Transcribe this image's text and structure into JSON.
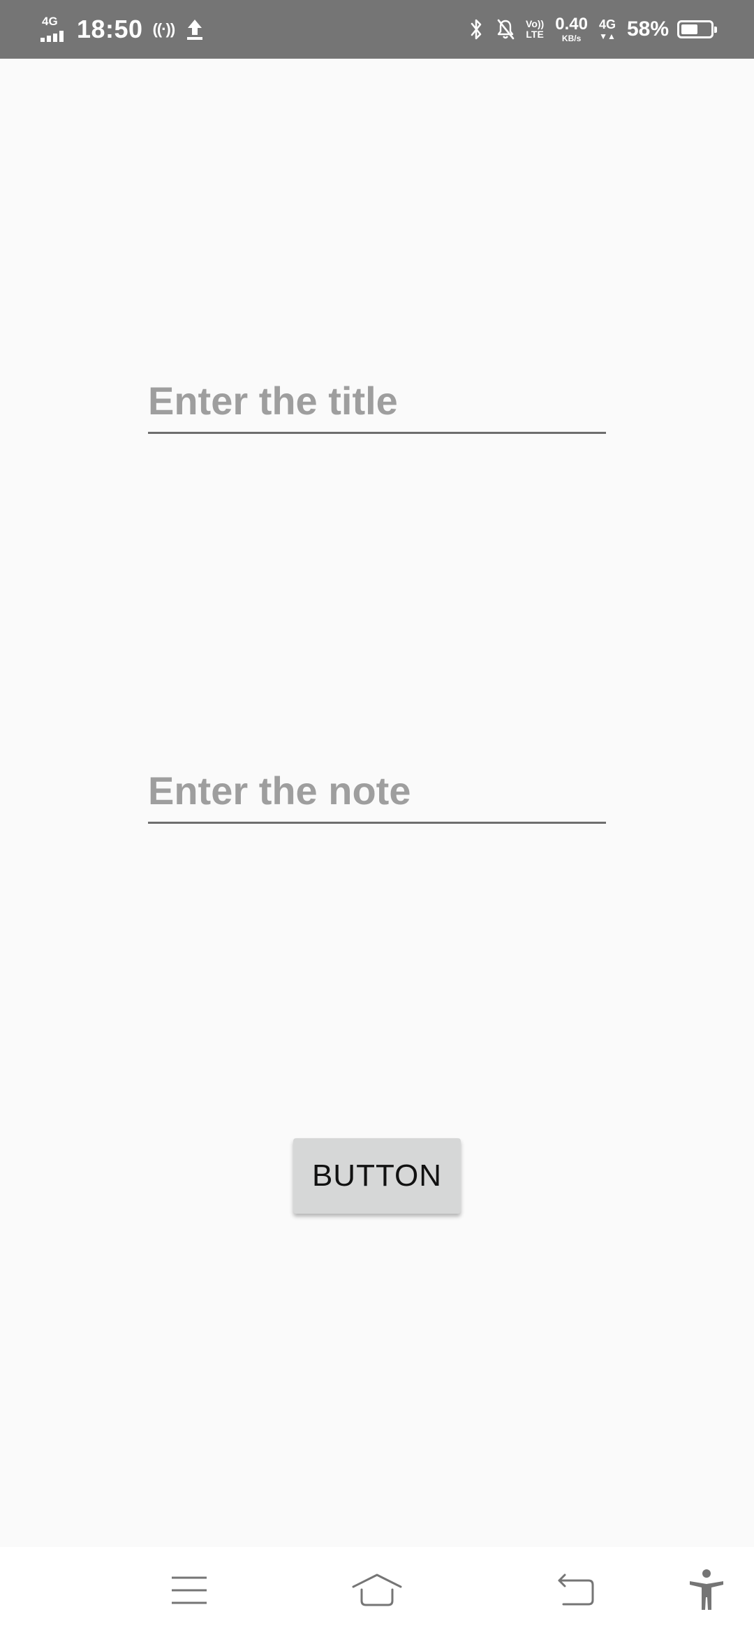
{
  "status_bar": {
    "network_label": "4G",
    "time": "18:50",
    "volte_top": "Vo))",
    "volte_bottom": "LTE",
    "speed_value": "0.40",
    "speed_unit": "KB/s",
    "data_label": "4G",
    "data_arrows": "▼▲",
    "battery_percent": "58%",
    "battery_level": 0.58,
    "icons": [
      "signal-icon",
      "hotspot-icon",
      "upload-icon",
      "bluetooth-icon",
      "notifications-off-icon",
      "battery-icon"
    ]
  },
  "form": {
    "title_placeholder": "Enter the title",
    "title_value": "",
    "note_placeholder": "Enter the note",
    "note_value": "",
    "button_label": "BUTTON"
  },
  "nav_bar": {
    "icons": [
      "menu-icon",
      "home-icon",
      "back-icon",
      "accessibility-icon"
    ]
  },
  "colors": {
    "status_bar_bg": "#757575",
    "page_bg": "#fafafa",
    "placeholder": "#9e9e9e",
    "underline": "#6e6e6e",
    "button_bg": "#d6d7d7",
    "nav_icon": "#757575"
  }
}
